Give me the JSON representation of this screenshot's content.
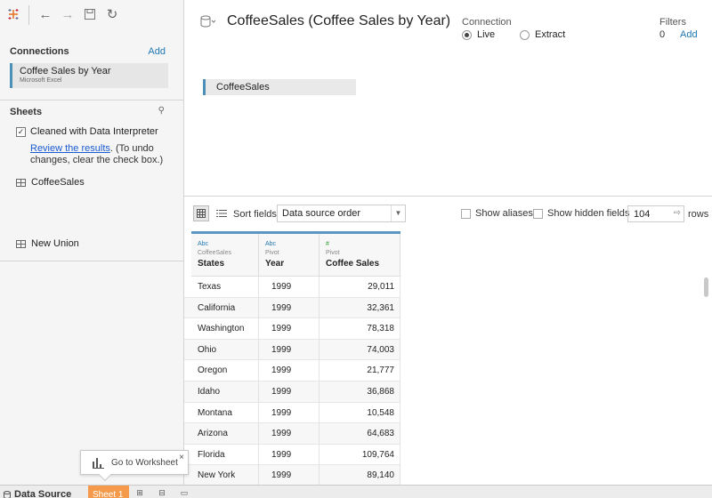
{
  "sidebar": {
    "connections_label": "Connections",
    "add_label": "Add",
    "connection": {
      "name": "Coffee Sales by Year",
      "type": "Microsoft Excel"
    },
    "sheets_label": "Sheets",
    "data_interpreter": {
      "label": "Cleaned with Data Interpreter",
      "link": "Review the results",
      "note": ". (To undo changes, clear the check box.)"
    },
    "sheet_items": [
      "CoffeeSales"
    ],
    "new_union_label": "New Union"
  },
  "header": {
    "datasource_title": "CoffeeSales (Coffee Sales by Year)",
    "connection_label": "Connection",
    "live_label": "Live",
    "extract_label": "Extract",
    "connection_mode": "Live",
    "filters_label": "Filters",
    "filters_count": "0",
    "filters_add": "Add"
  },
  "canvas": {
    "table_name": "CoffeeSales"
  },
  "grid_toolbar": {
    "sort_label": "Sort fields",
    "sort_value": "Data source order",
    "show_aliases": "Show aliases",
    "show_hidden": "Show hidden fields",
    "rows_value": "104",
    "rows_label": "rows"
  },
  "grid": {
    "columns": [
      {
        "type_icon": "Abc",
        "source": "CoffeeSales",
        "name": "States"
      },
      {
        "type_icon": "Abc",
        "source": "Pivot",
        "name": "Year"
      },
      {
        "type_icon": "#",
        "source": "Pivot",
        "name": "Coffee Sales"
      }
    ],
    "rows": [
      [
        "Texas",
        "1999",
        "29,011"
      ],
      [
        "California",
        "1999",
        "32,361"
      ],
      [
        "Washington",
        "1999",
        "78,318"
      ],
      [
        "Ohio",
        "1999",
        "74,003"
      ],
      [
        "Oregon",
        "1999",
        "21,777"
      ],
      [
        "Idaho",
        "1999",
        "36,868"
      ],
      [
        "Montana",
        "1999",
        "10,548"
      ],
      [
        "Arizona",
        "1999",
        "64,683"
      ],
      [
        "Florida",
        "1999",
        "109,764"
      ],
      [
        "New York",
        "1999",
        "89,140"
      ]
    ]
  },
  "tooltip": {
    "text": "Go to Worksheet",
    "close": "×"
  },
  "tabs": {
    "data_source": "Data Source",
    "sheet1": "Sheet 1"
  },
  "colors": {
    "accent": "#4c8fb7",
    "sheet_tab": "#f59a4a",
    "link": "#1f77b4"
  }
}
